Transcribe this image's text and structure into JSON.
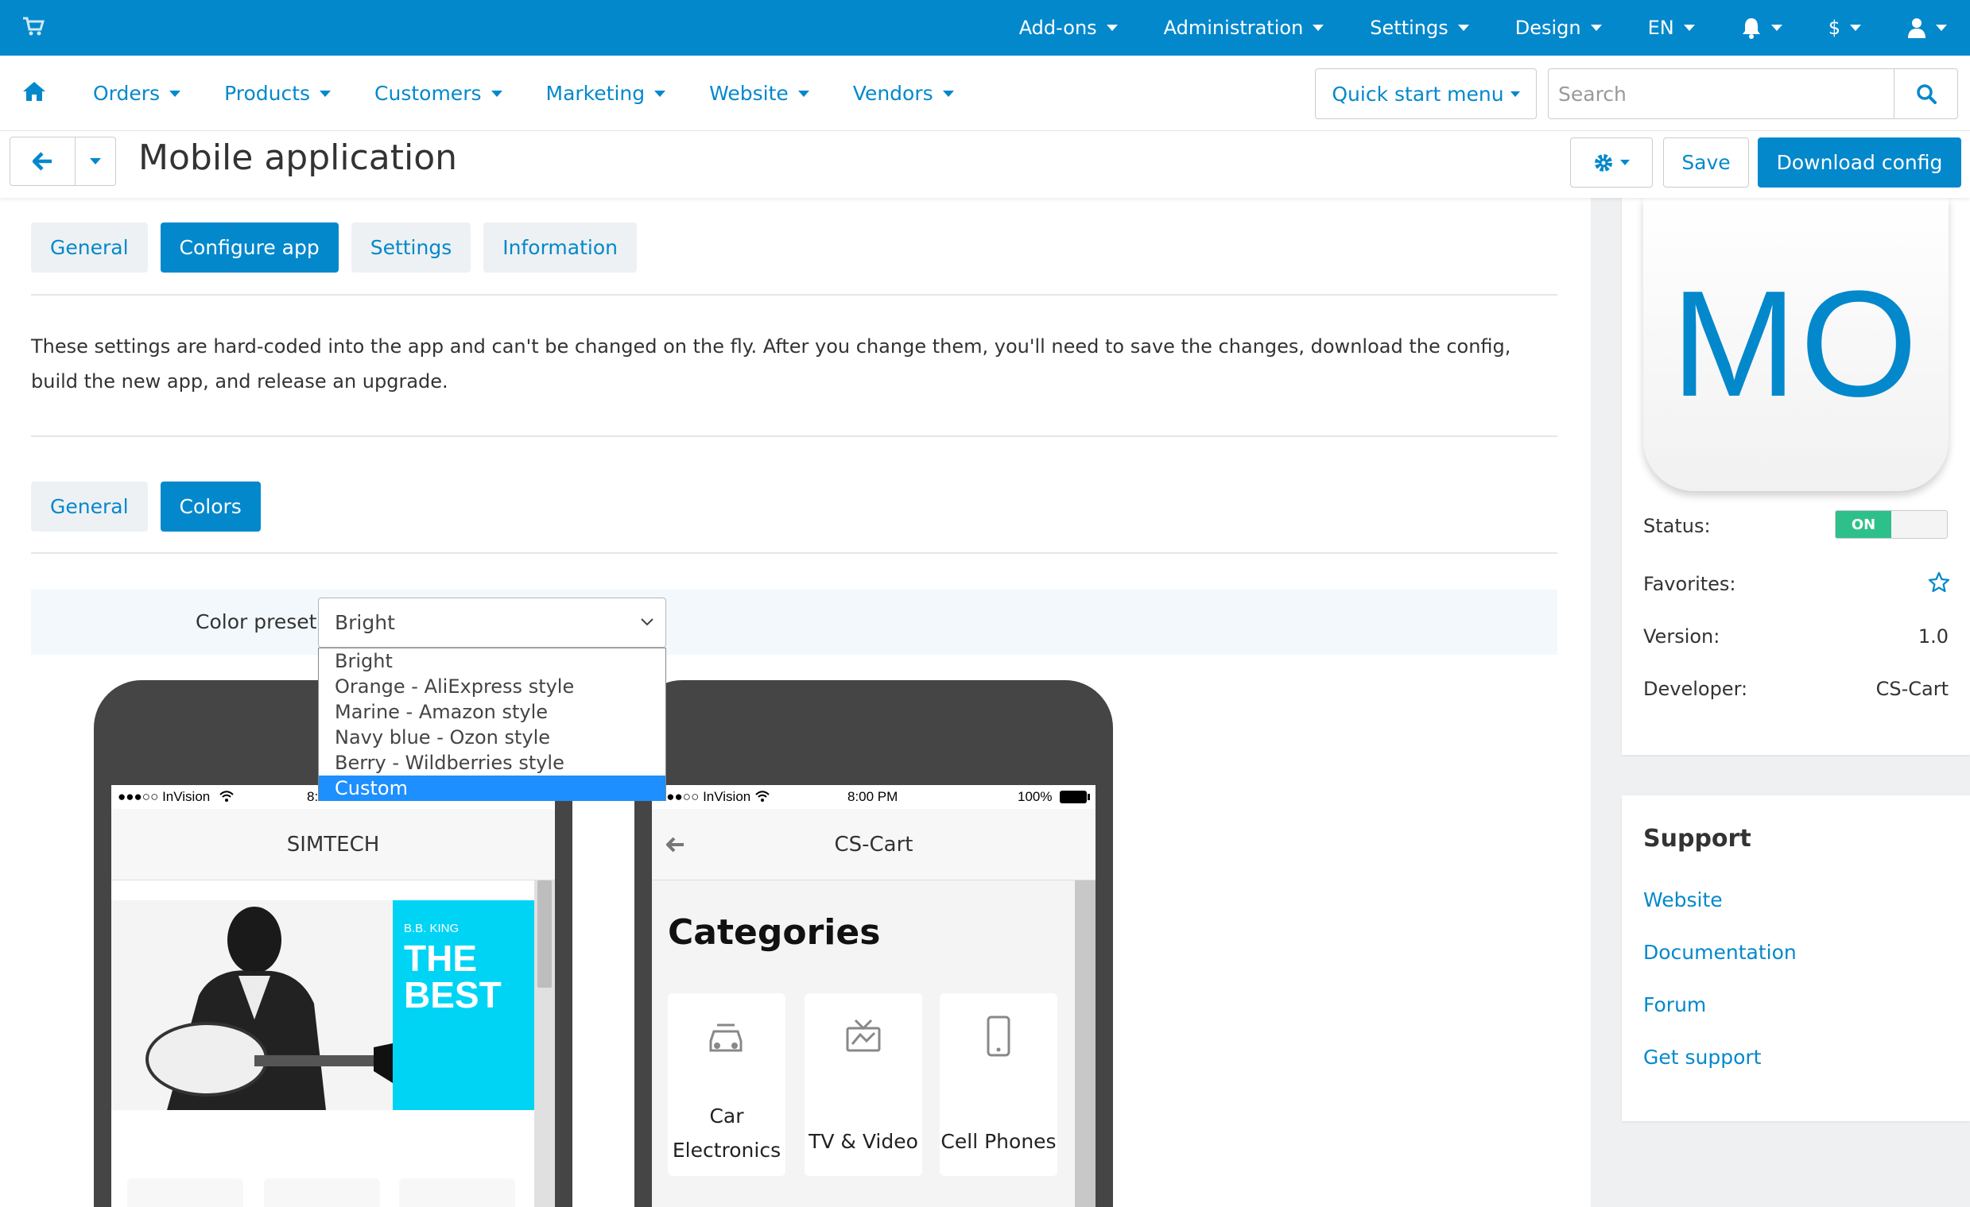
{
  "topbar": {
    "items": [
      {
        "label": "Add-ons"
      },
      {
        "label": "Administration"
      },
      {
        "label": "Settings"
      },
      {
        "label": "Design"
      },
      {
        "label": "EN"
      }
    ],
    "currency": "$",
    "color": "#0388cc"
  },
  "nav": {
    "items": [
      {
        "label": "Orders"
      },
      {
        "label": "Products"
      },
      {
        "label": "Customers"
      },
      {
        "label": "Marketing"
      },
      {
        "label": "Website"
      },
      {
        "label": "Vendors"
      }
    ],
    "quick_start": "Quick start menu",
    "search_placeholder": "Search"
  },
  "titlebar": {
    "title": "Mobile application",
    "save": "Save",
    "download": "Download config"
  },
  "tabs": [
    {
      "label": "General",
      "active": false
    },
    {
      "label": "Configure app",
      "active": true
    },
    {
      "label": "Settings",
      "active": false
    },
    {
      "label": "Information",
      "active": false
    }
  ],
  "notice": "These settings are hard-coded into the app and can't be changed on the fly. After you change them, you'll need to save the changes, download the config, build the new app, and release an upgrade.",
  "subtabs": [
    {
      "label": "General",
      "active": false
    },
    {
      "label": "Colors",
      "active": true
    }
  ],
  "preset": {
    "label": "Color preset:",
    "value": "Bright",
    "options": [
      "Bright",
      "Orange - AliExpress style",
      "Marine - Amazon style",
      "Navy blue - Ozon style",
      "Berry - Wildberries style",
      "Custom"
    ],
    "highlighted": "Custom"
  },
  "phone_left": {
    "carrier": "●●●○○ InVision",
    "time": "8:",
    "appbar_title": "SIMTECH",
    "banner_small": "B.B. KING",
    "banner_big_1": "THE",
    "banner_big_2": "BEST",
    "banner_color": "#00d4f5"
  },
  "phone_right": {
    "carrier": "●●●○○ InVision",
    "time": "8:00 PM",
    "battery": "100%",
    "appbar_title": "CS-Cart",
    "heading": "Categories",
    "categories": [
      {
        "line1": "Car",
        "line2": "Electronics",
        "icon": "car-icon"
      },
      {
        "line1": "TV & Video",
        "line2": "",
        "icon": "tv-icon"
      },
      {
        "line1": "Cell Phones",
        "line2": "",
        "icon": "phone-icon"
      }
    ]
  },
  "sidebar": {
    "logo_text": "MO",
    "status_label": "Status:",
    "status_value": "ON",
    "favorites_label": "Favorites:",
    "version_label": "Version:",
    "version_value": "1.0",
    "developer_label": "Developer:",
    "developer_value": "CS-Cart",
    "support_title": "Support",
    "support_links": [
      "Website",
      "Documentation",
      "Forum",
      "Get support"
    ]
  }
}
